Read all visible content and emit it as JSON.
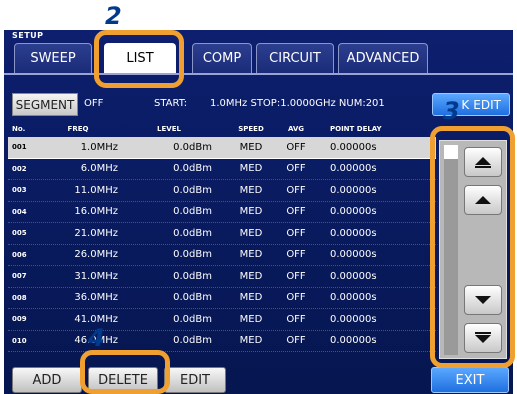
{
  "header": {
    "setup_label": "SETUP"
  },
  "tabs": [
    {
      "label": "SWEEP"
    },
    {
      "label": "LIST"
    },
    {
      "label": "COMP"
    },
    {
      "label": "CIRCUIT"
    },
    {
      "label": "ADVANCED"
    }
  ],
  "segment": {
    "button_label": "SEGMENT",
    "state": "OFF",
    "start_label": "START:",
    "summary": "1.0MHz STOP:1.0000GHz NUM:201",
    "edit_label": "EDIT",
    "edit_prefix": "K"
  },
  "table": {
    "headers": [
      "No.",
      "FREQ",
      "LEVEL",
      "SPEED",
      "AVG",
      "POINT DELAY"
    ],
    "rows": [
      {
        "no": "001",
        "freq": "1.0MHz",
        "level": "0.0dBm",
        "speed": "MED",
        "avg": "OFF",
        "delay": "0.00000s"
      },
      {
        "no": "002",
        "freq": "6.0MHz",
        "level": "0.0dBm",
        "speed": "MED",
        "avg": "OFF",
        "delay": "0.00000s"
      },
      {
        "no": "003",
        "freq": "11.0MHz",
        "level": "0.0dBm",
        "speed": "MED",
        "avg": "OFF",
        "delay": "0.00000s"
      },
      {
        "no": "004",
        "freq": "16.0MHz",
        "level": "0.0dBm",
        "speed": "MED",
        "avg": "OFF",
        "delay": "0.00000s"
      },
      {
        "no": "005",
        "freq": "21.0MHz",
        "level": "0.0dBm",
        "speed": "MED",
        "avg": "OFF",
        "delay": "0.00000s"
      },
      {
        "no": "006",
        "freq": "26.0MHz",
        "level": "0.0dBm",
        "speed": "MED",
        "avg": "OFF",
        "delay": "0.00000s"
      },
      {
        "no": "007",
        "freq": "31.0MHz",
        "level": "0.0dBm",
        "speed": "MED",
        "avg": "OFF",
        "delay": "0.00000s"
      },
      {
        "no": "008",
        "freq": "36.0MHz",
        "level": "0.0dBm",
        "speed": "MED",
        "avg": "OFF",
        "delay": "0.00000s"
      },
      {
        "no": "009",
        "freq": "41.0MHz",
        "level": "0.0dBm",
        "speed": "MED",
        "avg": "OFF",
        "delay": "0.00000s"
      },
      {
        "no": "010",
        "freq": "46.0MHz",
        "level": "0.0dBm",
        "speed": "MED",
        "avg": "OFF",
        "delay": "0.00000s"
      }
    ]
  },
  "scroll": {
    "up_double_icon": "double-up-arrow-icon",
    "up_icon": "up-arrow-icon",
    "down_icon": "down-arrow-icon",
    "down_double_icon": "double-down-arrow-icon"
  },
  "buttons": {
    "add": "ADD",
    "delete": "DELETE",
    "edit": "EDIT",
    "exit": "EXIT"
  },
  "callouts": {
    "n2": "2",
    "n3": "3",
    "n4": "4"
  },
  "colors": {
    "callout": "#f0a030",
    "callout_number": "#003a8c",
    "accent": "#1f6fe0"
  }
}
